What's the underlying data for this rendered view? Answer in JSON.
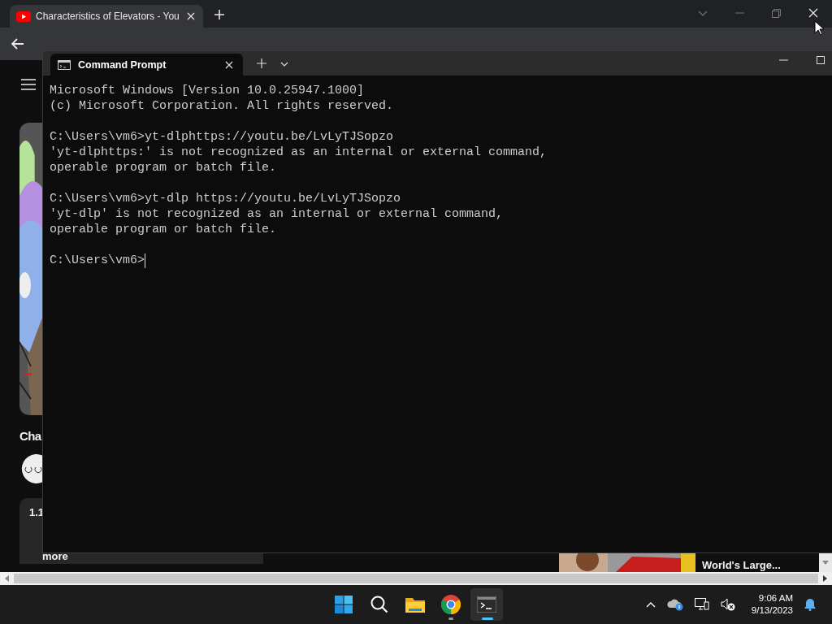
{
  "browser": {
    "tabs": [
      {
        "title": "Characteristics of Elevators - You",
        "selected": true
      }
    ],
    "page": {
      "video_title": "Cha",
      "description": {
        "heading": "1.1",
        "more_link": "more"
      },
      "related_video": {
        "title": "World's Large..."
      }
    }
  },
  "terminal": {
    "tabs": [
      {
        "title": "Command Prompt",
        "selected": true
      }
    ],
    "blocks": [
      [
        "Microsoft Windows [Version 10.0.25947.1000]",
        "(c) Microsoft Corporation. All rights reserved."
      ],
      [
        "C:\\Users\\vm6>yt-dlphttps://youtu.be/LvLyTJSopzo",
        "'yt-dlphttps:' is not recognized as an internal or external command,",
        "operable program or batch file."
      ],
      [
        "C:\\Users\\vm6>yt-dlp https://youtu.be/LvLyTJSopzo",
        "'yt-dlp' is not recognized as an internal or external command,",
        "operable program or batch file."
      ]
    ],
    "prompt": "C:\\Users\\vm6>",
    "cursor_visible": true
  },
  "taskbar": {
    "apps": [
      {
        "kind": "start",
        "running": false,
        "selected": false
      },
      {
        "kind": "search",
        "running": false,
        "selected": false
      },
      {
        "kind": "explorer",
        "running": false,
        "selected": false
      },
      {
        "kind": "chrome",
        "running": true,
        "selected": false
      },
      {
        "kind": "terminal",
        "running": true,
        "selected": true
      }
    ],
    "clock": {
      "time": "9:06 AM",
      "date": "9/13/2023"
    }
  }
}
